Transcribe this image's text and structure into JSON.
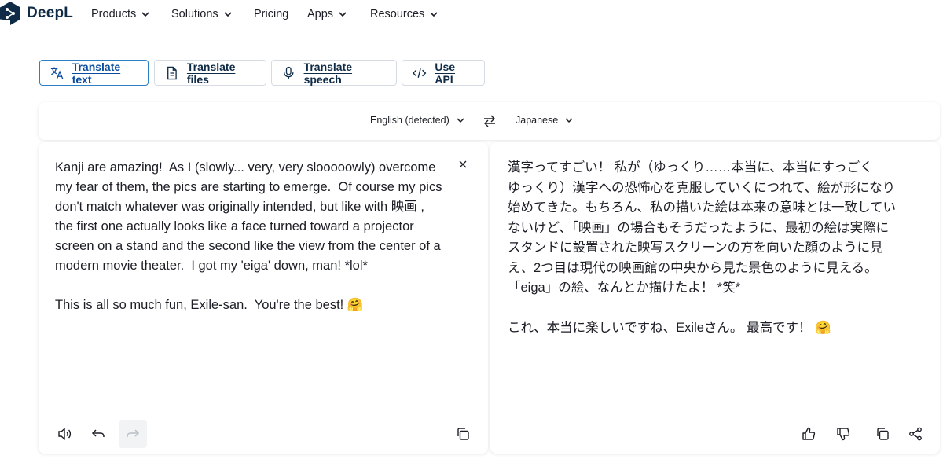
{
  "nav": {
    "logo_text": "DeepL",
    "items": [
      {
        "label": "Products"
      },
      {
        "label": "Solutions"
      },
      {
        "label": "Pricing"
      },
      {
        "label": "Apps"
      },
      {
        "label": "Resources"
      }
    ]
  },
  "tabs": [
    {
      "label": "Translate text",
      "icon": "translate-icon",
      "active": true
    },
    {
      "label": "Translate files",
      "icon": "file-icon",
      "active": false
    },
    {
      "label": "Translate speech",
      "icon": "microphone-icon",
      "active": false
    },
    {
      "label": "Use API",
      "icon": "code-icon",
      "active": false
    }
  ],
  "languages": {
    "source": "English (detected)",
    "target": "Japanese"
  },
  "source_text": "Kanji are amazing!  As I (slowly... very, very slooooowly) overcome\nmy fear of them, the pics are starting to emerge.  Of course my pics\ndon't match whatever was originally intended, but like with 映画 ,\nthe first one actually looks like a face turned toward a projector\nscreen on a stand and the second like the view from the center of a\nmodern movie theater.  I got my 'eiga' down, man! *lol*\n\nThis is all so much fun, Exile-san.  You're the best! 🤗",
  "target_text": "漢字ってすごい！ 私が（ゆっくり……本当に、本当にすっごく\nゆっくり）漢字への恐怖心を克服していくにつれて、絵が形になり\n始めてきた。もちろん、私の描いた絵は本来の意味とは一致してい\nないけど、「映画」の場合もそうだったように、最初の絵は実際に\nスタンドに設置された映写スクリーンの方を向いた顔のように見\nえ、2つ目は現代の映画館の中央から見た景色のように見える。\n「eiga」の絵、なんとか描けたよ！ *笑*\n\nこれ、本当に楽しいですね、Exileさん。 最高です！ 🤗",
  "colors": {
    "accent": "#2d7fc4",
    "logo": "#0f2b46",
    "text": "#1b1e25",
    "border": "#d6dce4"
  }
}
